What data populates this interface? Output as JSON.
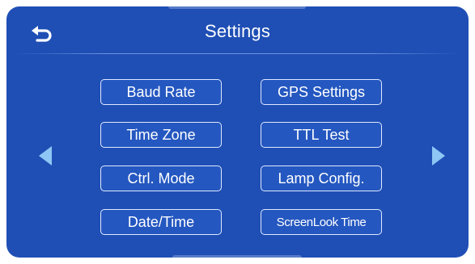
{
  "header": {
    "title": "Settings",
    "back_icon": "back-arrow-icon"
  },
  "menu": {
    "left": [
      {
        "label": "Baud Rate"
      },
      {
        "label": "Time Zone"
      },
      {
        "label": "Ctrl. Mode"
      },
      {
        "label": "Date/Time"
      }
    ],
    "right": [
      {
        "label": "GPS Settings"
      },
      {
        "label": "TTL Test"
      },
      {
        "label": "Lamp Config."
      },
      {
        "label": "ScreenLook Time"
      }
    ]
  },
  "navigation": {
    "prev_icon": "triangle-left-icon",
    "next_icon": "triangle-right-icon"
  },
  "colors": {
    "background": "#1f4fb5",
    "button_border": "#dfe9ff",
    "arrow": "#8ec7f5"
  }
}
